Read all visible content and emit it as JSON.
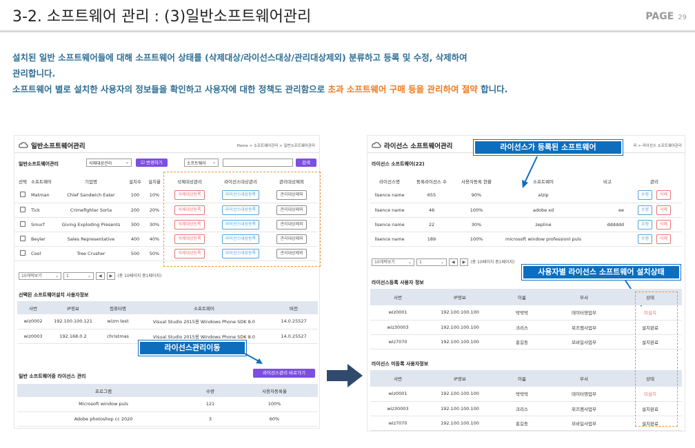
{
  "header": {
    "title": "3-2. 소프트웨어 관리 : (3)일반소프트웨어관리",
    "page_label": "PAGE",
    "page_num": "29"
  },
  "desc": {
    "line1": "설치된 일반 소프트웨어들에 대해 소프트웨어 상태를 (삭제대상/라이선스대상/관리대상제외) 분류하고 등록 및 수정, 삭제하여",
    "line2": "관리합니다.",
    "line3a": "소프트웨어 별로 설치한 사용자의 정보들을 확인하고 사용자에 대한 정책도 관리함으로 ",
    "line3b": "초과 소프트웨어 구매 등을 관리하여 절약",
    "line3c": " 합니다."
  },
  "left": {
    "title": "일반소프트웨어관리",
    "crumb": "Home > 소프트웨어관리 > 일반소프트웨어관리",
    "section": "일반소프트웨어관리",
    "filter_select": "삭제대상관리",
    "change_btn": "☑ 변경하기",
    "sw_select": "소프트웨어",
    "search_btn": "검색",
    "cols": [
      "선택",
      "소프트웨어",
      "기업명",
      "설치수",
      "설치율",
      "삭제대상관리",
      "라이선스대상관리",
      "관리대상제외"
    ],
    "rows": [
      {
        "sw": "Matman",
        "co": "Chief Sandwich Eater",
        "cnt": "100",
        "rate": "10%"
      },
      {
        "sw": "Tick",
        "co": "Crimefighter Sorta",
        "cnt": "200",
        "rate": "20%"
      },
      {
        "sw": "Smurf",
        "co": "Giving Exploding Presents",
        "cnt": "300",
        "rate": "30%"
      },
      {
        "sw": "Beyler",
        "co": "Sales Representative",
        "cnt": "400",
        "rate": "40%"
      },
      {
        "sw": "Cool",
        "co": "Tree Crusher",
        "cnt": "500",
        "rate": "50%"
      }
    ],
    "btn_del": "삭제대상등록",
    "btn_lic": "라이선스대상등록",
    "btn_ex": "관리대상제외",
    "page_size": "10개씩보기",
    "page_no": "1",
    "page_info": "(총 10페이지 중1페이지)",
    "user_section": "선택된 소프트웨어설치 사용자정보",
    "user_cols": [
      "사번",
      "IP정보",
      "컴퓨터명",
      "소프트웨어",
      "버전"
    ],
    "users": [
      {
        "id": "wiz0002",
        "ip": "192.100.100.121",
        "pc": "wizm test",
        "sw": "Visual Studio 2015용 Windows Phone SDK 8.0",
        "ver": "14.0.25527"
      },
      {
        "id": "wiz0003",
        "ip": "192.168.0.2",
        "pc": "christmas",
        "sw": "Visual Studio 2015용 Windows Phone SDK 8.0",
        "ver": "14.0.25527"
      }
    ],
    "lic_section": "일반 소프트웨어중 라이선스 관리",
    "goto_btn": "라이선스관리 바로가기",
    "lic_cols": [
      "프로그램",
      "수량",
      "사용자등록율"
    ],
    "lics": [
      {
        "p": "Microsoft window puls",
        "q": "121",
        "r": "100%"
      },
      {
        "p": "Adobe photoshop cc 2020",
        "q": "3",
        "r": "60%"
      }
    ],
    "callout": "라이선스관리이동"
  },
  "right": {
    "title": "라이선스 소프트웨어관리",
    "crumb": "리 > 라이선스 소프트웨어관리",
    "section": "라이선스 소프트웨어(22)",
    "cols": [
      "라이선스명",
      "등록라이선스 수",
      "사용자등록 현황",
      "소프트웨어",
      "비고",
      "관리"
    ],
    "rows": [
      {
        "n": "lisence name",
        "c": "655",
        "s": "90%",
        "sw": "alzip",
        "note": ""
      },
      {
        "n": "lisence name",
        "c": "46",
        "s": "100%",
        "sw": "adobe xd",
        "note": "ee"
      },
      {
        "n": "lisence name",
        "c": "22",
        "s": "30%",
        "sw": "zepline",
        "note": "dddddd"
      },
      {
        "n": "lisence name",
        "c": "189",
        "s": "100%",
        "sw": "microsoft window professionl puls",
        "note": ""
      }
    ],
    "edit": "수정",
    "del": "삭제",
    "page_size": "10개씩보기",
    "page_no": "1",
    "page_info": "(총 10페이지 중1페이지)",
    "reg_section": "라이선스등록 사용자 정보",
    "unreg_section": "라이선스 미등록 사용자정보",
    "user_cols": [
      "사번",
      "IP정보",
      "이름",
      "부서",
      "상태"
    ],
    "reg_users": [
      {
        "id": "wiz0001",
        "ip": "192.100.100.100",
        "nm": "박박박",
        "dp": "데이터영업부",
        "st": "미설치",
        "red": true
      },
      {
        "id": "wiz30003",
        "ip": "192.100.100.100",
        "nm": "크리스",
        "dp": "위즈엠사업부",
        "st": "설치완료",
        "red": false
      },
      {
        "id": "wiz7070",
        "ip": "192.100.100.100",
        "nm": "홍길동",
        "dp": "모바일사업부",
        "st": "설치완료",
        "red": false
      }
    ],
    "unreg_users": [
      {
        "id": "wiz0001",
        "ip": "192.100.100.100",
        "nm": "박박박",
        "dp": "데이터영업부",
        "st": "미설치",
        "red": true
      },
      {
        "id": "wiz30003",
        "ip": "192.100.100.100",
        "nm": "크리스",
        "dp": "위즈엠사업부",
        "st": "설치완료",
        "red": false
      },
      {
        "id": "wiz7070",
        "ip": "192.100.100.100",
        "nm": "홍길동",
        "dp": "모바일사업부",
        "st": "설치완료",
        "red": false
      }
    ],
    "callout1": "라이선스가 등록된 소프트웨어",
    "callout2": "사용자별 라이선스 소프트웨어 설치상태"
  }
}
